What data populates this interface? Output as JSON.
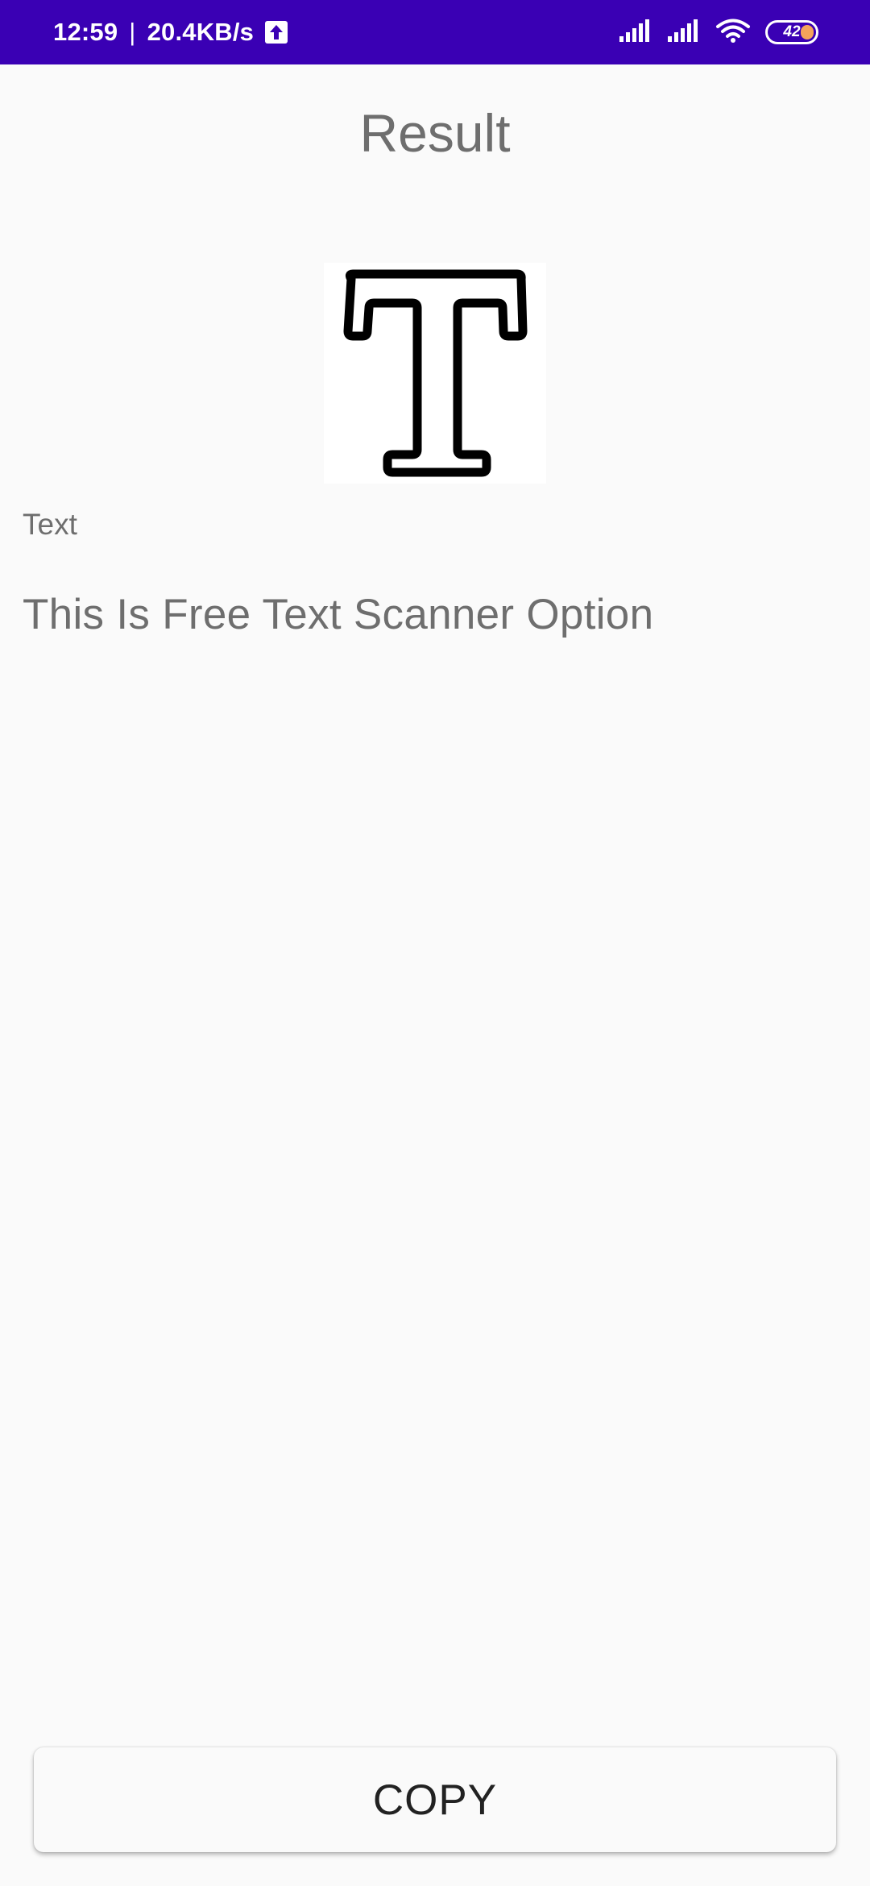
{
  "status_bar": {
    "time": "12:59",
    "separator": "|",
    "network_speed": "20.4KB/s",
    "battery_level": "42",
    "background_color": "#3a00b4",
    "icons": [
      "upload-icon",
      "signal-icon",
      "signal-icon",
      "wifi-icon",
      "battery-icon"
    ]
  },
  "page": {
    "title": "Result",
    "image_icon": "letter-t-icon",
    "text_label": "Text",
    "result_text": "This Is Free Text Scanner Option"
  },
  "actions": {
    "copy_label": "COPY"
  }
}
